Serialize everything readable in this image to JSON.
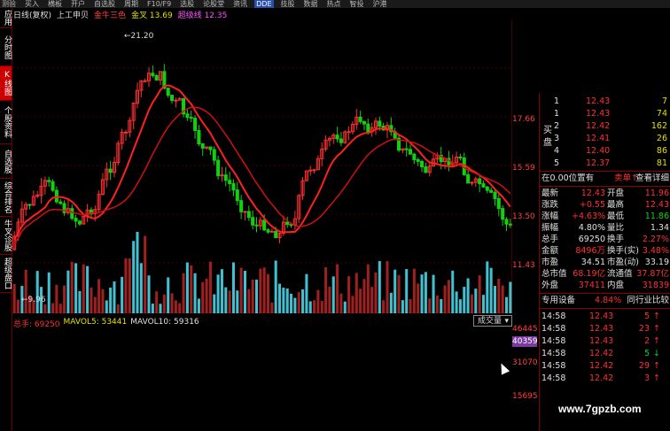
{
  "menubar": [
    "测验",
    "买入",
    "横板",
    "开户",
    "自选股",
    "周期",
    "F10/F9",
    "选股",
    "论股堂",
    "资讯",
    "DDE",
    "技股",
    "数据",
    "热点",
    "智投",
    "沪港"
  ],
  "menubar_selected": "DDE",
  "leftbar": [
    {
      "label": "应用",
      "active": false
    },
    {
      "label": "分时图",
      "active": false
    },
    {
      "label": "K线图",
      "active": true
    },
    {
      "label": "个股资料",
      "active": false
    },
    {
      "label": "自选股",
      "active": false
    },
    {
      "label": "综合排名",
      "active": false
    },
    {
      "label": "牛叉诊股",
      "active": false
    },
    {
      "label": "超级盘口",
      "active": false
    }
  ],
  "chart_title": {
    "period": "日线(复权)",
    "indicator": "上工申贝",
    "ind1": "金牛三色",
    "ind2_label": "金叉 13.69",
    "ind3_label": "超级线 12.35"
  },
  "price_axis": [
    "17.66",
    "15.59",
    "13.50",
    "11.43"
  ],
  "price_annotations": {
    "high": "21.20",
    "low": "9.96"
  },
  "volume_title": {
    "total_label": "总手: 69250",
    "mavol5": "MAVOL5: 53441",
    "mavol10": "MAVOL10: 59316"
  },
  "volume_axis": [
    "46445",
    "40359",
    "31070",
    "15695"
  ],
  "volume_dropdown": "成交量",
  "orderbook": {
    "buy_label": "买盘",
    "rows": [
      {
        "level": "1",
        "price": "12.43",
        "vol": "7"
      },
      {
        "level": "1",
        "price": "12.43",
        "vol": "74"
      },
      {
        "level": "2",
        "price": "12.42",
        "vol": "162"
      },
      {
        "level": "3",
        "price": "12.41",
        "vol": "26"
      },
      {
        "level": "4",
        "price": "12.40",
        "vol": "86"
      },
      {
        "level": "5",
        "price": "12.37",
        "vol": "81"
      }
    ]
  },
  "position_bar": {
    "left": "在0.00位置有",
    "mid": "卖单↑",
    "right": "查看详细"
  },
  "stats": [
    {
      "k1": "最新",
      "v1": "12.43",
      "k2": "开盘",
      "v2": "11.96"
    },
    {
      "k1": "涨跌",
      "v1": "+0.55",
      "k2": "最高",
      "v2": "12.43"
    },
    {
      "k1": "涨幅",
      "v1": "+4.63%",
      "k2": "最低",
      "v2": "11.86"
    },
    {
      "k1": "振幅",
      "v1": "4.80%",
      "k2": "量比",
      "v2": "1.34"
    },
    {
      "k1": "总手",
      "v1": "69250",
      "k2": "换手",
      "v2": "2.27%"
    },
    {
      "k1": "金额",
      "v1": "8496万",
      "k2": "换手(实)",
      "v2": "3.48%"
    },
    {
      "k1": "市盈",
      "v1": "34.51",
      "k2": "市盈(动)",
      "v2": "33.19"
    },
    {
      "k1": "总市值",
      "v1": "68.19亿",
      "k2": "流通值",
      "v2": "37.87亿"
    },
    {
      "k1": "外盘",
      "v1": "37411",
      "k2": "内盘",
      "v2": "31839"
    }
  ],
  "sector_bar": {
    "name": "专用设备",
    "pct": "4.84%",
    "compare": "同行业比较"
  },
  "ticks": [
    {
      "time": "14:58",
      "price": "12.43",
      "vol": "5",
      "dir": "up"
    },
    {
      "time": "14:58",
      "price": "12.43",
      "vol": "23",
      "dir": "up"
    },
    {
      "time": "14:58",
      "price": "12.43",
      "vol": "2",
      "dir": "up"
    },
    {
      "time": "14:58",
      "price": "12.42",
      "vol": "5",
      "dir": "down"
    },
    {
      "time": "14:58",
      "price": "12.42",
      "vol": "29",
      "dir": "up"
    },
    {
      "time": "14:58",
      "price": "12.42",
      "vol": "3",
      "dir": "up"
    }
  ],
  "watermark": "www.7gpzb.com",
  "colors": {
    "up": "#ff3030",
    "down": "#10d010",
    "ma": "#ff2020",
    "bg": "#000000"
  }
}
